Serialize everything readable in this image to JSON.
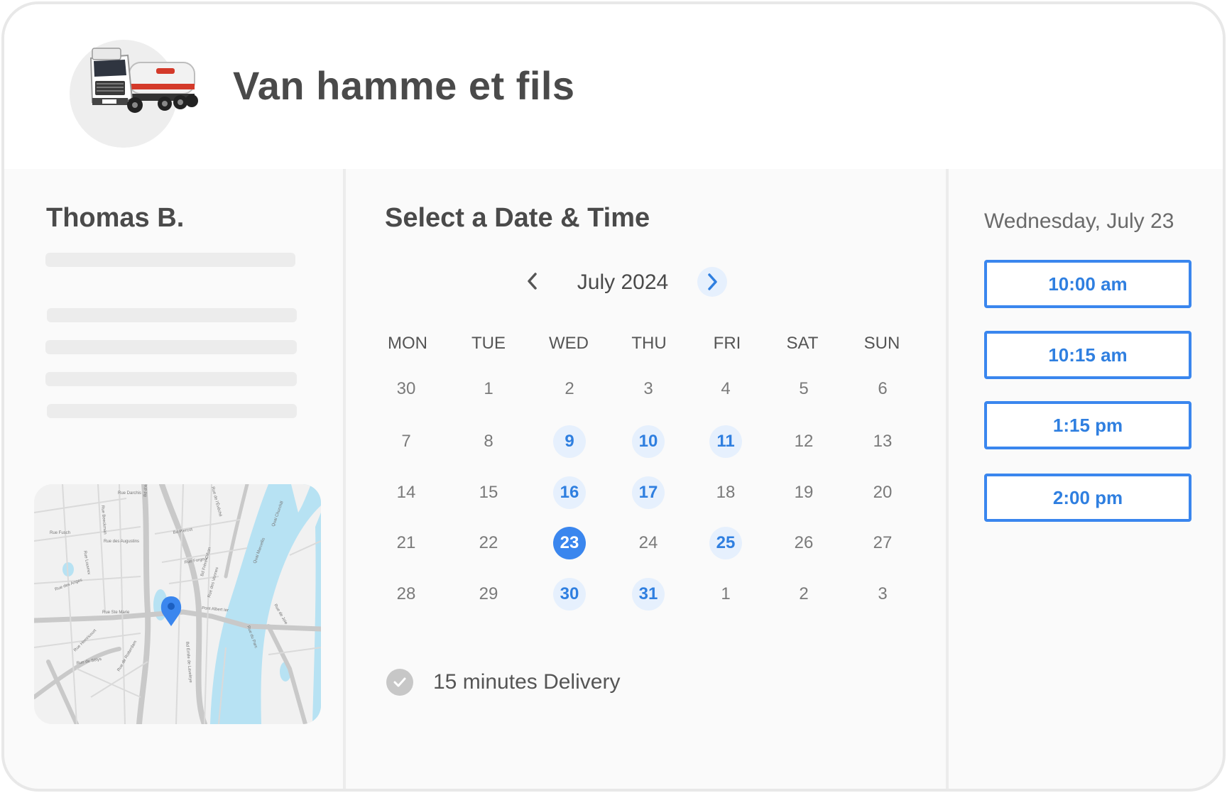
{
  "header": {
    "company_name": "Van hamme et fils",
    "logo_icon": "truck-icon"
  },
  "host": {
    "name": "Thomas B."
  },
  "scheduler": {
    "title": "Select a Date & Time",
    "month_label": "July 2024",
    "prev_icon": "chevron-left-icon",
    "next_icon": "chevron-right-icon",
    "weekdays": [
      "MON",
      "TUE",
      "WED",
      "THU",
      "FRI",
      "SAT",
      "SUN"
    ],
    "weeks": [
      [
        {
          "label": "30",
          "state": "muted"
        },
        {
          "label": "1",
          "state": "muted"
        },
        {
          "label": "2",
          "state": "muted"
        },
        {
          "label": "3",
          "state": "muted"
        },
        {
          "label": "4",
          "state": "muted"
        },
        {
          "label": "5",
          "state": "muted"
        },
        {
          "label": "6",
          "state": "muted"
        }
      ],
      [
        {
          "label": "7",
          "state": "muted"
        },
        {
          "label": "8",
          "state": "muted"
        },
        {
          "label": "9",
          "state": "available"
        },
        {
          "label": "10",
          "state": "available"
        },
        {
          "label": "11",
          "state": "available"
        },
        {
          "label": "12",
          "state": "muted"
        },
        {
          "label": "13",
          "state": "muted"
        }
      ],
      [
        {
          "label": "14",
          "state": "muted"
        },
        {
          "label": "15",
          "state": "muted"
        },
        {
          "label": "16",
          "state": "available"
        },
        {
          "label": "17",
          "state": "available"
        },
        {
          "label": "18",
          "state": "muted"
        },
        {
          "label": "19",
          "state": "muted"
        },
        {
          "label": "20",
          "state": "muted"
        }
      ],
      [
        {
          "label": "21",
          "state": "muted"
        },
        {
          "label": "22",
          "state": "muted"
        },
        {
          "label": "23",
          "state": "selected"
        },
        {
          "label": "24",
          "state": "muted"
        },
        {
          "label": "25",
          "state": "available"
        },
        {
          "label": "26",
          "state": "muted"
        },
        {
          "label": "27",
          "state": "muted"
        }
      ],
      [
        {
          "label": "28",
          "state": "muted"
        },
        {
          "label": "29",
          "state": "muted"
        },
        {
          "label": "30",
          "state": "available"
        },
        {
          "label": "31",
          "state": "available"
        },
        {
          "label": "1",
          "state": "muted"
        },
        {
          "label": "2",
          "state": "muted"
        },
        {
          "label": "3",
          "state": "muted"
        }
      ]
    ],
    "duration_label": "15 minutes Delivery",
    "duration_icon": "check-circle-icon"
  },
  "times": {
    "selected_date": "Wednesday, July 23",
    "slots": [
      "10:00 am",
      "10:15 am",
      "1:15 pm",
      "2:00 pm"
    ]
  },
  "map": {
    "streets": [
      "Rue Darchis",
      "Rue Fusch",
      "Rue Beeckman",
      "Bd d'Avroy",
      "Rue des Augustins",
      "Bd Piercot",
      "Rue Louvrex",
      "Rue Forgeur",
      "Bd Frère-Orban",
      "Rue de l'Évêché",
      "Rue des Anges",
      "Rue Ste Marie",
      "Pont Albert Ier",
      "Quai Marcellis",
      "Quai Churchill",
      "Rue des Vennes",
      "Rue de Sélys",
      "Rue Hemricourt",
      "Rue de Rotterdam",
      "Rue du Parc",
      "Bd Émile de Laveleye",
      "Rue de Joie"
    ],
    "marker_icon": "map-pin-icon",
    "colors": {
      "water": "#b7e2f3",
      "land": "#f1f1f1",
      "roads": "#c9c9c9",
      "marker": "#3a86ee"
    }
  },
  "colors": {
    "accent": "#3a86ee",
    "available_bg": "#e6f0fd",
    "text": "#4a4a4a"
  }
}
